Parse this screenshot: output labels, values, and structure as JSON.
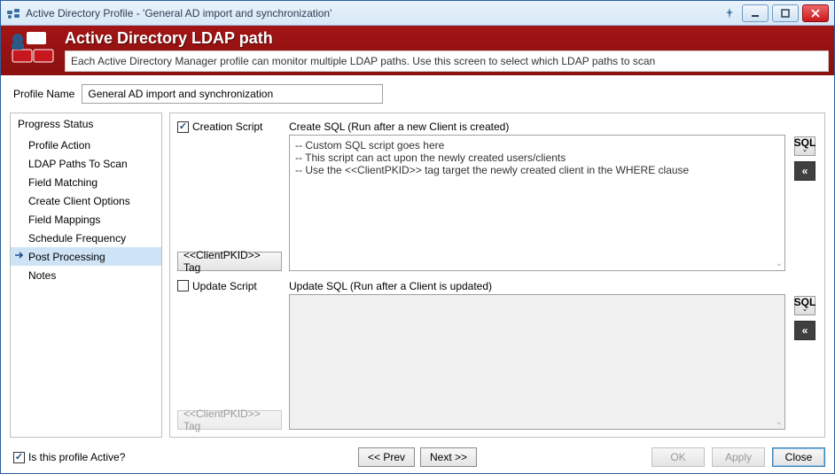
{
  "window": {
    "title": "Active Directory Profile - 'General AD import and synchronization'"
  },
  "banner": {
    "title": "Active Directory LDAP path",
    "description": "Each Active Directory Manager profile can monitor multiple LDAP paths.  Use this screen to select which LDAP paths to scan"
  },
  "profile": {
    "label": "Profile Name",
    "value": "General AD import and synchronization"
  },
  "sidebar": {
    "header": "Progress Status",
    "items": [
      {
        "label": "Profile Action",
        "selected": false
      },
      {
        "label": "LDAP Paths To Scan",
        "selected": false
      },
      {
        "label": "Field Matching",
        "selected": false
      },
      {
        "label": "Create Client Options",
        "selected": false
      },
      {
        "label": "Field Mappings",
        "selected": false
      },
      {
        "label": "Schedule Frequency",
        "selected": false
      },
      {
        "label": "Post Processing",
        "selected": true
      },
      {
        "label": "Notes",
        "selected": false
      }
    ]
  },
  "sections": {
    "create": {
      "checkbox_label": "Creation Script",
      "checked": true,
      "sql_label": "Create SQL (Run after a new Client is created)",
      "sql_text": "-- Custom SQL script goes here\n-- This script can act upon the newly created users/clients\n-- Use the <<ClientPKID>> tag target the newly created client in the WHERE clause",
      "tag_button": "<<ClientPKID>> Tag",
      "tool_sql": "SQL",
      "tool_exp": "«"
    },
    "update": {
      "checkbox_label": "Update Script",
      "checked": false,
      "sql_label": "Update SQL (Run after a Client is updated)",
      "sql_text": "",
      "tag_button": "<<ClientPKID>> Tag",
      "tool_sql": "SQL",
      "tool_exp": "«"
    }
  },
  "footer": {
    "active_label": "Is this profile Active?",
    "active_checked": true,
    "prev": "<< Prev",
    "next": "Next >>",
    "ok": "OK",
    "apply": "Apply",
    "close": "Close"
  }
}
